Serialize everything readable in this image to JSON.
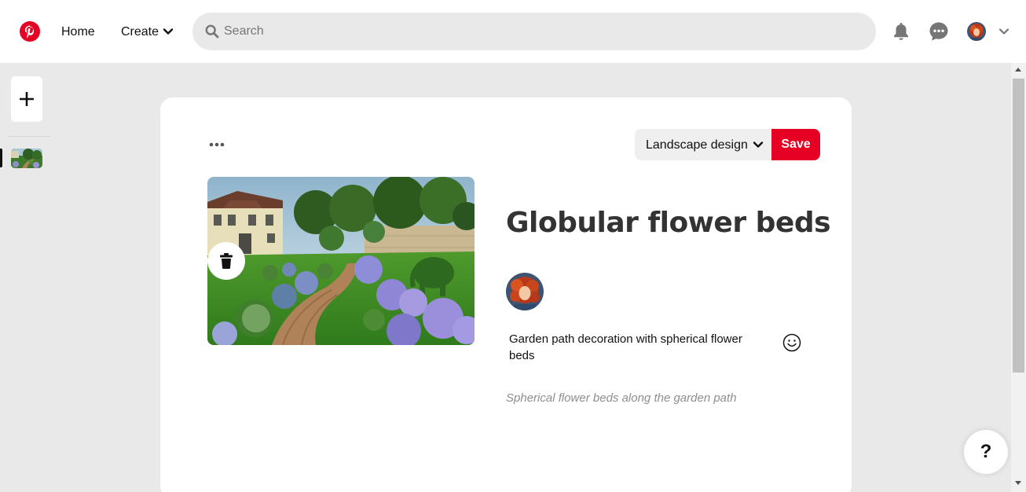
{
  "header": {
    "logo_icon": "pinterest-logo",
    "nav": {
      "home": "Home",
      "create": "Create"
    },
    "search": {
      "placeholder": "Search",
      "value": ""
    },
    "icons": [
      "bell-icon",
      "chat-icon",
      "chevron-down-icon"
    ]
  },
  "sidebar": {
    "add_icon": "plus-icon",
    "thumbnail": "garden-thumbnail"
  },
  "pin": {
    "board": "Landscape design",
    "save_label": "Save",
    "title": "Globular flower beds",
    "description": "Garden path decoration with spherical flower beds",
    "alt_text": "Spherical flower beds along the garden path"
  },
  "help": {
    "label": "?"
  },
  "colors": {
    "brand": "#e60023",
    "background": "#e9e9e9",
    "text": "#111111"
  }
}
